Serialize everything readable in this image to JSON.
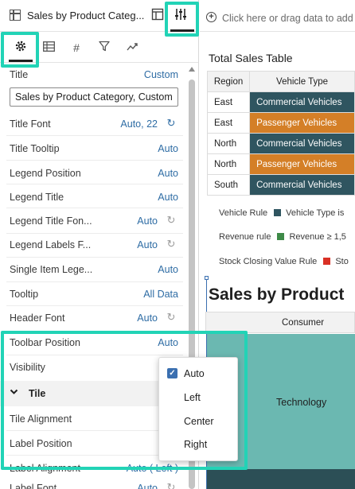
{
  "viz_title": "Sales by Product Categ...",
  "dropzone": {
    "placeholder": "Click here or drag data to add"
  },
  "properties": {
    "title_label": "Title",
    "title_mode": "Custom",
    "title_value": "Sales by Product Category, Custom",
    "rows": [
      {
        "label": "Title Font",
        "value": "Auto, 22"
      },
      {
        "label": "Title Tooltip",
        "value": "Auto"
      },
      {
        "label": "Legend Position",
        "value": "Auto"
      },
      {
        "label": "Legend Title",
        "value": "Auto"
      },
      {
        "label": "Legend Title Fon...",
        "value": "Auto"
      },
      {
        "label": "Legend Labels F...",
        "value": "Auto"
      },
      {
        "label": "Single Item Lege...",
        "value": "Auto"
      },
      {
        "label": "Tooltip",
        "value": "All Data"
      },
      {
        "label": "Header Font",
        "value": "Auto"
      },
      {
        "label": "Toolbar Position",
        "value": "Auto"
      },
      {
        "label": "Visibility",
        "value": "A"
      }
    ],
    "tile_section": "Tile",
    "tile_rows": [
      {
        "label": "Tile Alignment",
        "value": ""
      },
      {
        "label": "Label Position",
        "value": "A"
      },
      {
        "label": "Label Alignment",
        "value": "Auto ( Left )"
      },
      {
        "label": "Label Font",
        "value": "Auto"
      }
    ]
  },
  "dropdown": {
    "options": [
      "Auto",
      "Left",
      "Center",
      "Right"
    ],
    "selected": "Auto"
  },
  "table": {
    "title": "Total Sales Table",
    "headers": [
      "Region",
      "Vehicle Type"
    ],
    "rows": [
      {
        "region": "East",
        "type": "Commercial Vehicles",
        "color": "#2f5560"
      },
      {
        "region": "East",
        "type": "Passenger Vehicles",
        "color": "#d47f27"
      },
      {
        "region": "North",
        "type": "Commercial Vehicles",
        "color": "#2f5560"
      },
      {
        "region": "North",
        "type": "Passenger Vehicles",
        "color": "#d47f27"
      },
      {
        "region": "South",
        "type": "Commercial Vehicles",
        "color": "#2f5560"
      }
    ]
  },
  "rules": [
    {
      "name": "Vehicle Rule",
      "desc": "Vehicle Type is",
      "color": "#2f5560"
    },
    {
      "name": "Revenue rule",
      "desc": "Revenue ≥ 1,5",
      "color": "#3e8a48"
    },
    {
      "name": "Stock Closing Value Rule",
      "desc": "Sto",
      "color": "#d93025"
    }
  ],
  "chart": {
    "title": "Sales by Product",
    "column_header": "Consumer",
    "cell_label": "Technology",
    "cell_color": "#6bb8b1",
    "dark_color": "#2c4f56"
  },
  "highlight_color": "#22d3b6"
}
